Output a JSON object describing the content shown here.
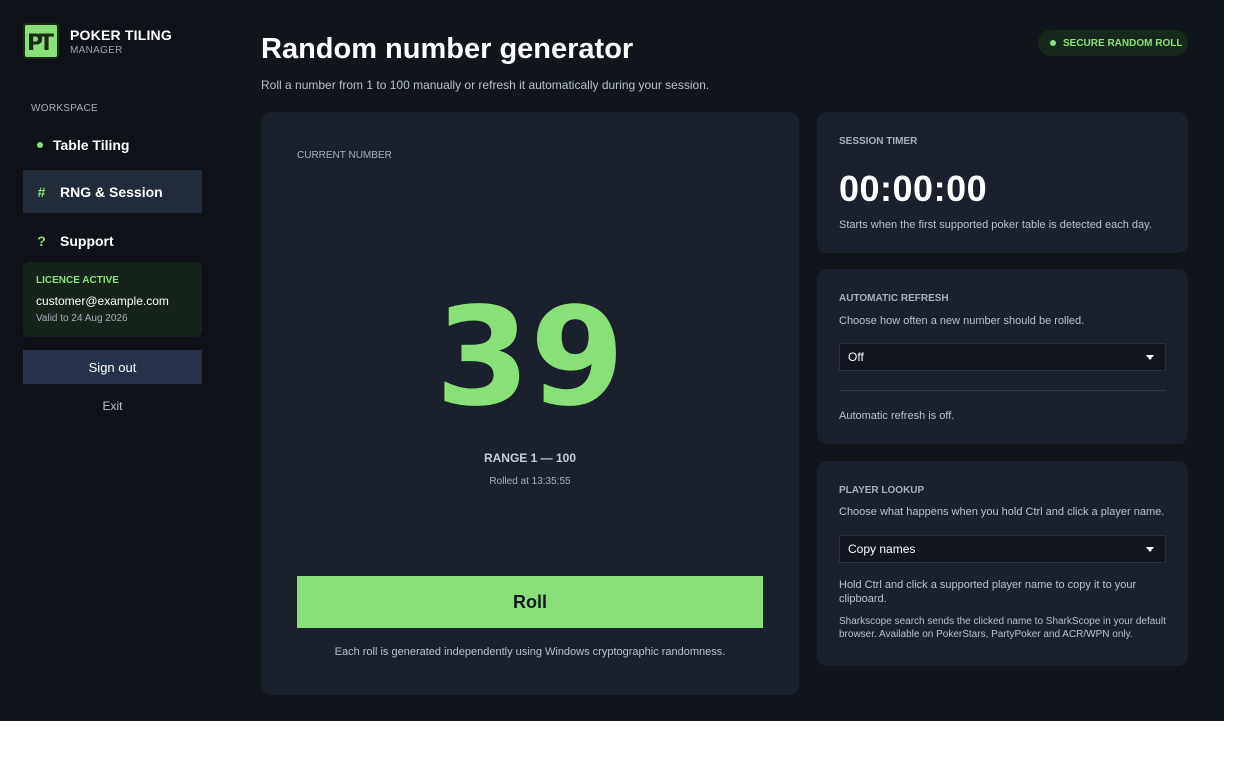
{
  "brand": {
    "title": "POKER TILING",
    "subtitle": "MANAGER",
    "logo_text": "PT"
  },
  "sidebar": {
    "section_label": "WORKSPACE",
    "items": [
      {
        "label": "Table Tiling",
        "icon": "dot-icon"
      },
      {
        "label": "RNG & Session",
        "icon": "#",
        "active": true
      },
      {
        "label": "Support",
        "icon": "?"
      }
    ],
    "licence": {
      "title": "LICENCE ACTIVE",
      "email": "customer@example.com",
      "valid": "Valid to 24 Aug 2026"
    },
    "signout_label": "Sign out",
    "exit_label": "Exit"
  },
  "header": {
    "title": "Random number generator",
    "subtitle": "Roll a number from 1 to 100 manually or refresh it automatically during your session.",
    "badge": "SECURE RANDOM ROLL"
  },
  "rng": {
    "label": "CURRENT NUMBER",
    "number": "39",
    "range": "RANGE  1 — 100",
    "rolled_at": "Rolled at 13:35:55",
    "roll_label": "Roll",
    "note": "Each roll is generated independently using Windows cryptographic randomness."
  },
  "timer": {
    "label": "SESSION TIMER",
    "value": "00:00:00",
    "desc": "Starts when the first supported poker table is detected each day."
  },
  "refresh": {
    "label": "AUTOMATIC REFRESH",
    "desc": "Choose how often a new number should be rolled.",
    "selected": "Off",
    "status": "Automatic refresh is off."
  },
  "lookup": {
    "label": "PLAYER LOOKUP",
    "desc": "Choose what happens when you hold Ctrl and click a player name.",
    "selected": "Copy names",
    "help1": "Hold Ctrl and click a supported player name to copy it to your clipboard.",
    "help2": "Sharkscope search sends the clicked name to SharkScope in your default browser. Available on PokerStars, PartyPoker and ACR/WPN only."
  },
  "colors": {
    "accent": "#8ae078",
    "background": "#11151c",
    "sidebar": "#0f1319",
    "card": "#1b212c"
  }
}
